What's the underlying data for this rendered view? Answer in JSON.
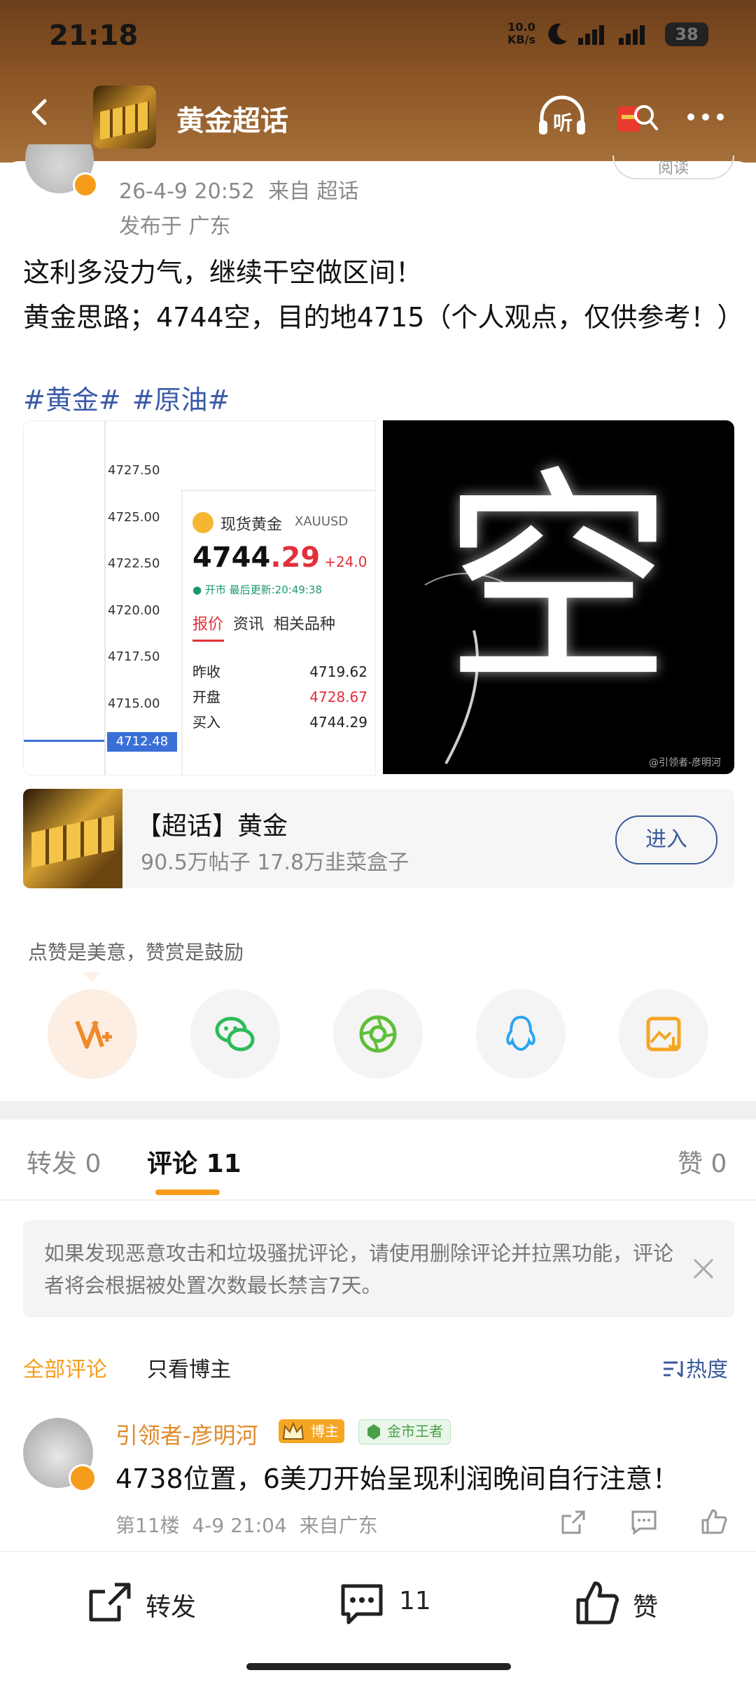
{
  "status_bar": {
    "time": "21:18",
    "net_speed_value": "10.0",
    "net_speed_unit": "KB/s",
    "battery": "38"
  },
  "header": {
    "title": "黄金超话",
    "listen_label": "听"
  },
  "post": {
    "date": "26-4-9 20:52",
    "source": "来自 超话",
    "location": "发布于 广东",
    "read_label": "阅读",
    "text_line1": "这利多没力气，继续干空做区间！",
    "text_line2": "黄金思路；4744空，目的地4715（个人观点，仅供参考！）",
    "tags": [
      "#黄金#",
      "#原油#"
    ]
  },
  "chart_image": {
    "price_labels": [
      "4727.50",
      "4725.00",
      "4722.50",
      "4720.00",
      "4717.50",
      "4715.00",
      "4712.48"
    ],
    "instrument": "现货黄金",
    "symbol": "XAUUSD",
    "price_main": "4744",
    "price_decimals": ".29",
    "change": "+24.0",
    "update_text": "● 开市 最后更新:20:49:38",
    "tabs": [
      "报价",
      "资讯",
      "相关品种"
    ],
    "rows": [
      {
        "label": "昨收",
        "value": "4719.62"
      },
      {
        "label": "开盘",
        "value": "4728.67"
      },
      {
        "label": "买入",
        "value": "4744.29"
      }
    ]
  },
  "art_image": {
    "character": "空",
    "watermark": "@引领者-彦明河"
  },
  "topic_card": {
    "title": "【超话】黄金",
    "stats": "90.5万帖子 17.8万韭菜盒子",
    "enter_label": "进入"
  },
  "share": {
    "tip": "点赞是美意，赞赏是鼓励"
  },
  "tabs": {
    "repost": "转发",
    "repost_count": "0",
    "comment": "评论",
    "comment_count": "11",
    "like": "赞",
    "like_count": "0"
  },
  "notice": {
    "text": "如果发现恶意攻击和垃圾骚扰评论，请使用删除评论并拉黑功能，评论者将会根据被处置次数最长禁言7天。"
  },
  "filters": {
    "all": "全部评论",
    "op_only": "只看博主",
    "sort": "热度"
  },
  "comment": {
    "author": "引领者-彦明河",
    "badge_op": "博主",
    "badge_rank": "金市王者",
    "text": "4738位置，6美刀开始呈现利润晚间自行注意！",
    "floor": "第11楼",
    "time": "4-9 21:04",
    "source": "来自广东"
  },
  "bottom_bar": {
    "repost": "转发",
    "comment_count": "11",
    "like": "赞"
  },
  "colors": {
    "accent": "#f59d1b",
    "link": "#3b5aa8",
    "header": "#8a5424"
  }
}
